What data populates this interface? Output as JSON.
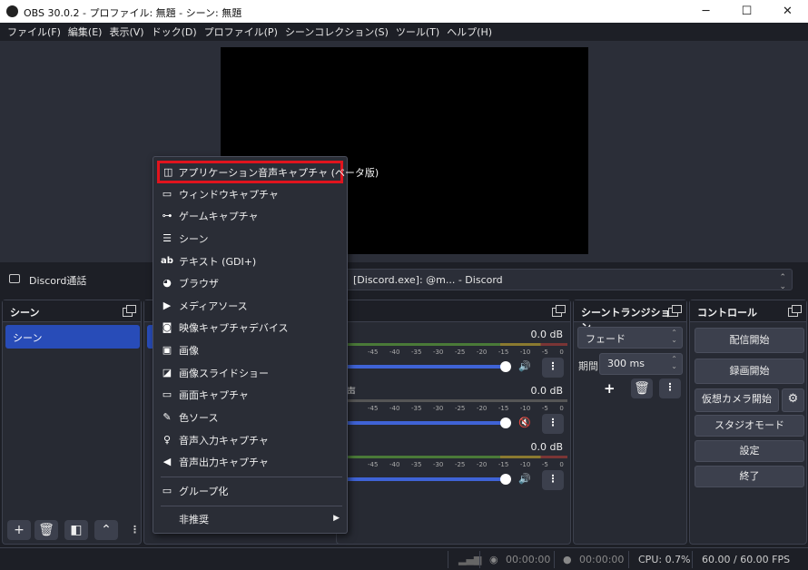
{
  "window": {
    "title": "OBS 30.0.2 - プロファイル: 無題 - シーン: 無題",
    "minimize": "─",
    "maximize": "☐",
    "close": "✕"
  },
  "menubar": [
    "ファイル(F)",
    "編集(E)",
    "表示(V)",
    "ドック(D)",
    "プロファイル(P)",
    "シーンコレクション(S)",
    "ツール(T)",
    "ヘルプ(H)"
  ],
  "source_bar": {
    "name": "Discord通話",
    "window_select": "[Discord.exe]: @m... - Discord"
  },
  "scenes": {
    "title": "シーン",
    "items": [
      "シーン"
    ]
  },
  "mixer": {
    "ticks": [
      "-45",
      "-40",
      "-35",
      "-30",
      "-25",
      "-20",
      "-15",
      "-10",
      "-5",
      "0"
    ],
    "channels": [
      {
        "value": "0.0 dB",
        "label": "",
        "muted": false
      },
      {
        "value": "0.0 dB",
        "label": "声",
        "muted": true
      },
      {
        "value": "0.0 dB",
        "label": "",
        "muted": false
      }
    ]
  },
  "transitions": {
    "title": "シーントランジション",
    "selected": "フェード",
    "duration_label": "期間",
    "duration": "300 ms"
  },
  "controls": {
    "title": "コントロール",
    "start_stream": "配信開始",
    "start_record": "録画開始",
    "virtual_cam": "仮想カメラ開始",
    "studio_mode": "スタジオモード",
    "settings": "設定",
    "exit": "終了"
  },
  "status": {
    "stream_time": "00:00:00",
    "record_time": "00:00:00",
    "cpu": "CPU: 0.7%",
    "fps": "60.00 / 60.00 FPS"
  },
  "context_menu": {
    "items": [
      {
        "label": "アプリケーション音声キャプチャ (ベータ版)",
        "icon": "app-audio-icon"
      },
      {
        "label": "ウィンドウキャプチャ",
        "icon": "window-icon"
      },
      {
        "label": "ゲームキャプチャ",
        "icon": "gamepad-icon"
      },
      {
        "label": "シーン",
        "icon": "list-icon"
      },
      {
        "label": "テキスト (GDI+)",
        "icon": "text-icon"
      },
      {
        "label": "ブラウザ",
        "icon": "globe-icon"
      },
      {
        "label": "メディアソース",
        "icon": "play-icon"
      },
      {
        "label": "映像キャプチャデバイス",
        "icon": "camera-icon"
      },
      {
        "label": "画像",
        "icon": "image-icon"
      },
      {
        "label": "画像スライドショー",
        "icon": "slideshow-icon"
      },
      {
        "label": "画面キャプチャ",
        "icon": "monitor-icon"
      },
      {
        "label": "色ソース",
        "icon": "brush-icon"
      },
      {
        "label": "音声入力キャプチャ",
        "icon": "mic-icon"
      },
      {
        "label": "音声出力キャプチャ",
        "icon": "speaker-icon"
      }
    ],
    "group": "グループ化",
    "deprecated": "非推奨",
    "highlight_color": "#e0141e"
  }
}
